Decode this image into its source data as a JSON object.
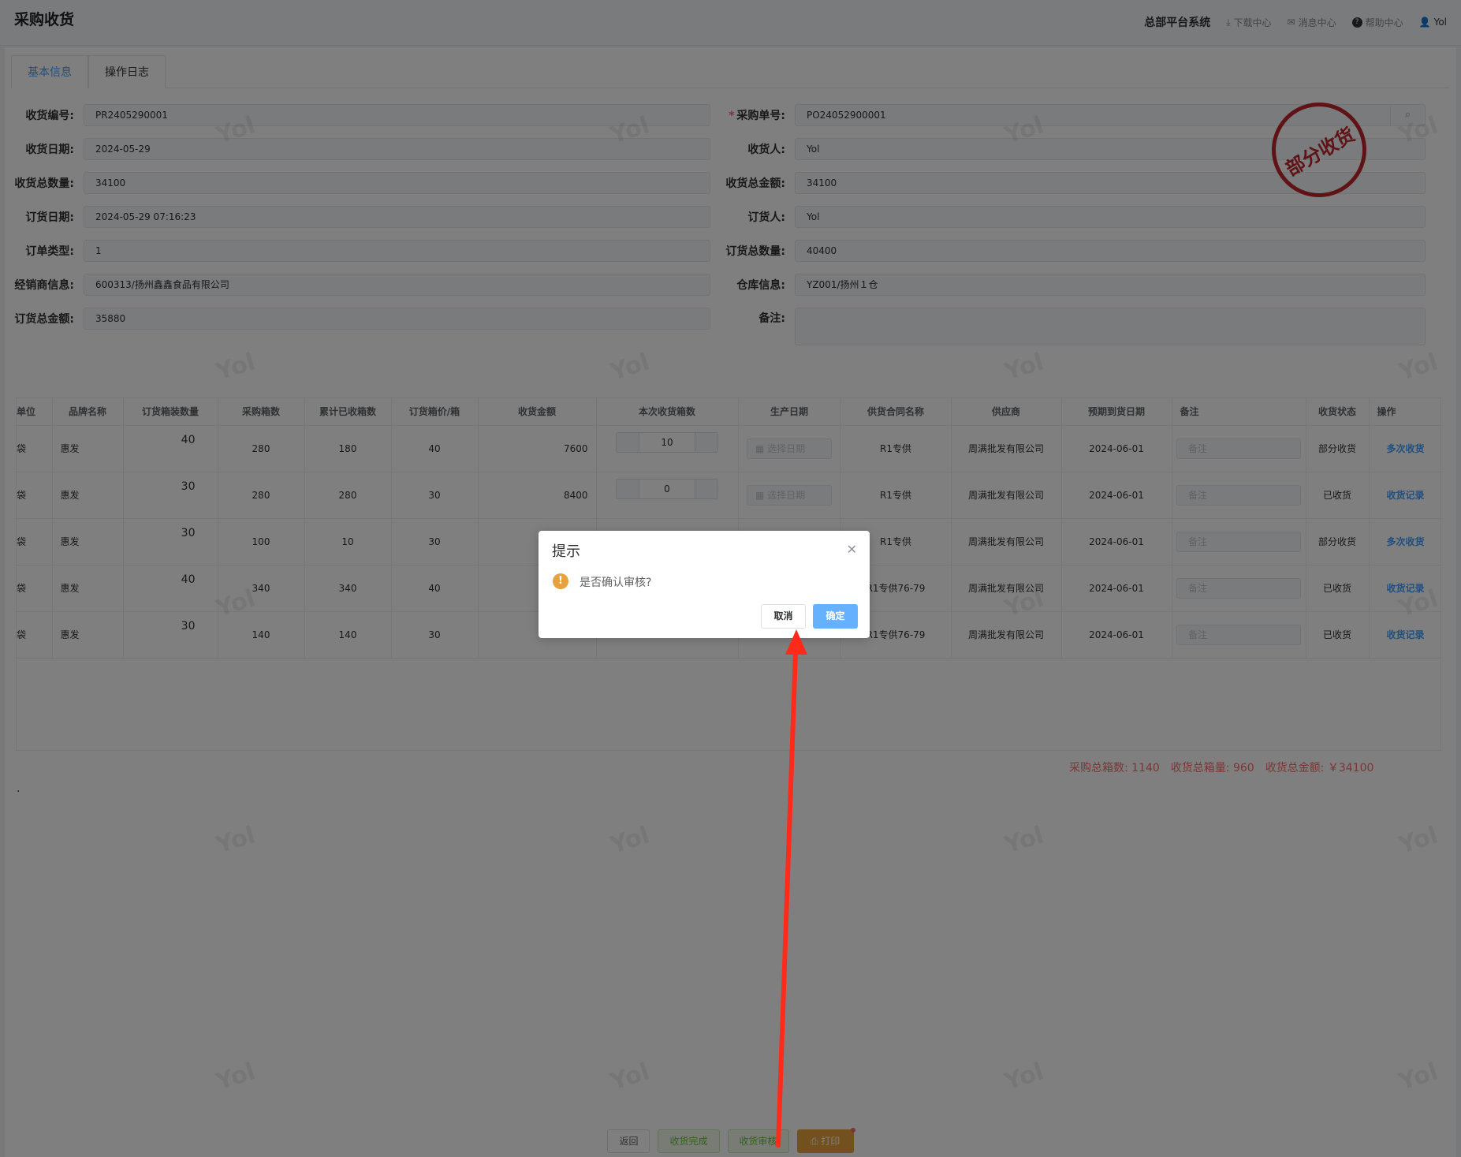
{
  "header": {
    "title": "采购收货",
    "system": "总部平台系统",
    "links": [
      "下载中心",
      "消息中心",
      "帮助中心"
    ],
    "user": "Yol"
  },
  "tabs": [
    "基本信息",
    "操作日志"
  ],
  "stamp": "部分收货",
  "form": {
    "left": [
      {
        "label": "收货编号:",
        "value": "PR2405290001"
      },
      {
        "label": "收货日期:",
        "value": "2024-05-29"
      },
      {
        "label": "收货总数量:",
        "value": "34100"
      },
      {
        "label": "订货日期:",
        "value": "2024-05-29 07:16:23"
      },
      {
        "label": "订单类型:",
        "value": "1"
      },
      {
        "label": "经销商信息:",
        "value": "600313/扬州鑫鑫食品有限公司"
      },
      {
        "label": "订货总金额:",
        "value": "35880"
      }
    ],
    "right": [
      {
        "label": "采购单号:",
        "value": "PO24052900001",
        "required": true
      },
      {
        "label": "收货人:",
        "value": "Yol"
      },
      {
        "label": "收货总金额:",
        "value": "34100"
      },
      {
        "label": "订货人:",
        "value": "Yol"
      },
      {
        "label": "订货总数量:",
        "value": "40400"
      },
      {
        "label": "仓库信息:",
        "value": "YZ001/扬州１仓"
      },
      {
        "label": "备注:",
        "value": ""
      }
    ]
  },
  "table": {
    "headers": [
      "单位",
      "品牌名称",
      "订货箱装数量",
      "采购箱数",
      "累计已收箱数",
      "订货箱价/箱",
      "收货金额",
      "本次收货箱数",
      "生产日期",
      "供货合同名称",
      "供应商",
      "预期到货日期",
      "备注",
      "收货状态",
      "操作"
    ],
    "date_placeholder": "选择日期",
    "remark_placeholder": "备注",
    "rows": [
      {
        "unit": "袋",
        "brand": "惠发",
        "box_qty": "40",
        "purchase": "280",
        "received": "180",
        "price": "40",
        "amount": "7600",
        "this_recv": "10",
        "contract": "R1专供",
        "supplier": "周满批发有限公司",
        "eta": "2024-06-01",
        "status": "部分收货",
        "op": "多次收货"
      },
      {
        "unit": "袋",
        "brand": "惠发",
        "box_qty": "30",
        "purchase": "280",
        "received": "280",
        "price": "30",
        "amount": "8400",
        "this_recv": "0",
        "contract": "R1专供",
        "supplier": "周满批发有限公司",
        "eta": "2024-06-01",
        "status": "已收货",
        "op": "收货记录"
      },
      {
        "unit": "袋",
        "brand": "惠发",
        "box_qty": "30",
        "purchase": "100",
        "received": "10",
        "price": "30",
        "amount": "",
        "this_recv": "",
        "contract": "R1专供",
        "supplier": "周满批发有限公司",
        "eta": "2024-06-01",
        "status": "部分收货",
        "op": "多次收货"
      },
      {
        "unit": "袋",
        "brand": "惠发",
        "box_qty": "40",
        "purchase": "340",
        "received": "340",
        "price": "40",
        "amount": "",
        "this_recv": "",
        "contract": "R1专供76-79",
        "supplier": "周满批发有限公司",
        "eta": "2024-06-01",
        "status": "已收货",
        "op": "收货记录"
      },
      {
        "unit": "袋",
        "brand": "惠发",
        "box_qty": "30",
        "purchase": "140",
        "received": "140",
        "price": "30",
        "amount": "",
        "this_recv": "",
        "contract": "R1专供76-79",
        "supplier": "周满批发有限公司",
        "eta": "2024-06-01",
        "status": "已收货",
        "op": "收货记录"
      }
    ]
  },
  "summary": {
    "total_boxes": "采购总箱数: 1140",
    "total_recv_qty": "收货总箱量: 960",
    "total_recv_amount": "收货总金额: ￥34100"
  },
  "dot": ".",
  "bottom_buttons": {
    "back": "返回",
    "complete": "收货完成",
    "audit": "收货审核",
    "print": "打印"
  },
  "dialog": {
    "title": "提示",
    "message": "是否确认审核?",
    "cancel": "取消",
    "confirm": "确定"
  },
  "watermark_text": "Yol",
  "colors": {
    "primary": "#409eff",
    "danger": "#f56c6c",
    "warning": "#e6a23c",
    "success": "#67c23a",
    "stamp": "#c0262d",
    "arrow": "#ff2a1a"
  }
}
